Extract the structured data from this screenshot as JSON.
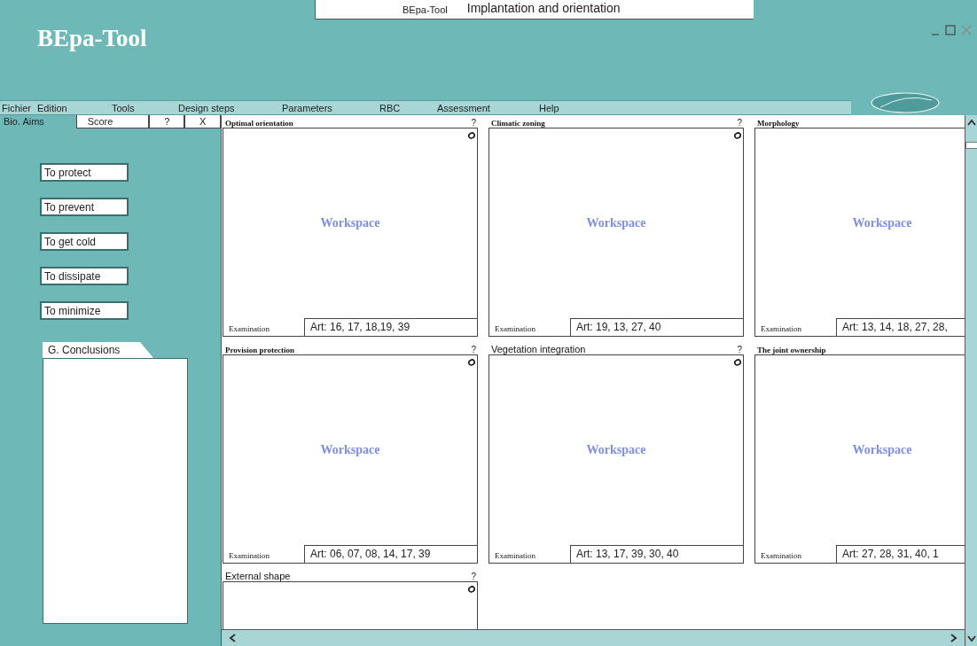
{
  "header": {
    "app_name": "BEpa-Tool",
    "document_tab": "BEpa-Tool",
    "document_title": "Implantation and orientation"
  },
  "menu": [
    "Fichier",
    "Edition",
    "Tools",
    "Design steps",
    "Parameters",
    "RBC",
    "Assessment",
    "Help"
  ],
  "side_tabs": [
    {
      "label": "Bio. Aims",
      "selected": true
    },
    {
      "label": "Score",
      "selected": false
    },
    {
      "label": "?",
      "selected": false
    },
    {
      "label": "X",
      "selected": false
    }
  ],
  "aims": [
    "To protect",
    "To prevent",
    "To get cold",
    "To dissipate",
    "To minimize"
  ],
  "conclusions_tab": "G. Conclusions",
  "panels": [
    {
      "title": "Optimal orientation",
      "kind": "serif",
      "help": "?",
      "workspace": "Workspace",
      "exam_label": "Examination",
      "exam_value": "Art: 16, 17, 18,19, 39"
    },
    {
      "title": "Climatic zoning",
      "kind": "serif",
      "help": "?",
      "workspace": "Workspace",
      "exam_label": "Examination",
      "exam_value": "Art: 19, 13, 27, 40"
    },
    {
      "title": "Morphology",
      "kind": "serif",
      "workspace": "Workspace",
      "exam_label": "Examination",
      "exam_value": "Art: 13, 14, 18, 27, 28,"
    },
    {
      "title": "Provision protection",
      "kind": "serif",
      "help": "?",
      "workspace": "Workspace",
      "exam_label": "Examination",
      "exam_value": "Art: 06, 07, 08, 14, 17, 39"
    },
    {
      "title": "Vegetation integration",
      "kind": "sans",
      "help": "?",
      "workspace": "Workspace",
      "exam_label": "Examination",
      "exam_value": "Art: 13, 17, 39, 30, 40"
    },
    {
      "title": "The joint ownership",
      "kind": "serif",
      "workspace": "Workspace",
      "exam_label": "Examination",
      "exam_value": "Art: 27, 28, 31, 40, 1"
    },
    {
      "title": "External shape",
      "kind": "sans",
      "help": "?"
    }
  ]
}
